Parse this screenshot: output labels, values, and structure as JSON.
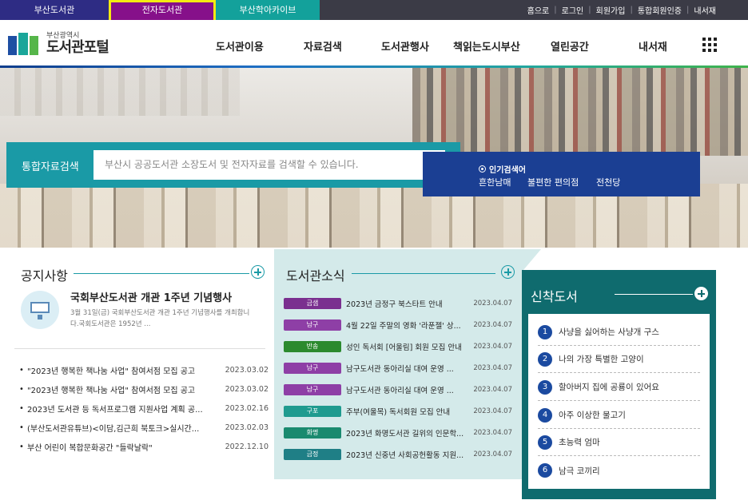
{
  "site_tabs": [
    {
      "label": "부산도서관"
    },
    {
      "label": "전자도서관"
    },
    {
      "label": "부산학아카이브"
    }
  ],
  "util_links": [
    "홈으로",
    "로그인",
    "회원가입",
    "통합회원인증",
    "내서재"
  ],
  "logo": {
    "sub": "부산광역시",
    "main": "도서관포털"
  },
  "gnb": [
    "도서관이용",
    "자료검색",
    "도서관행사",
    "책읽는도시부산",
    "열린공간",
    "내서재"
  ],
  "search": {
    "label": "통합자료검색",
    "placeholder": "부산시 공공도서관 소장도서 및 전자자료를 검색할 수 있습니다."
  },
  "popular": {
    "title": "인기검색어",
    "keywords": [
      "흔한남매",
      "불편한 편의점",
      "전천당"
    ]
  },
  "notice": {
    "title": "공지사항",
    "featured_title": "국회부산도서관 개관 1주년 기념행사",
    "featured_desc": "3월 31일(금) 국회부산도서관 개관 1주년 기념행사를 개최합니다.국회도서관은 1952년 ...",
    "items": [
      {
        "text": "\"2023년 행복한 책나눔 사업\" 참여서점 모집 공고",
        "date": "2023.03.02"
      },
      {
        "text": "\"2023년 행복한 책나눔 사업\" 참여서점 모집 공고",
        "date": "2023.03.02"
      },
      {
        "text": "2023년 도서관 등 독서프로그램 지원사업 계획 공...",
        "date": "2023.02.16"
      },
      {
        "text": "(부산도서관유튜브)<이담,김근희 북토크>실시간...",
        "date": "2023.02.03"
      },
      {
        "text": "부산 어린이 복합문화공간 \"들락날락\"",
        "date": "2022.12.10"
      }
    ]
  },
  "news": {
    "title": "도서관소식",
    "items": [
      {
        "tag": "금샘",
        "color": "#7a2f8f",
        "text": "2023년 금정구 북스타트 안내",
        "date": "2023.04.07"
      },
      {
        "tag": "남구",
        "color": "#8e3fa6",
        "text": "4월 22일 주말의 영화 '라푼젤' 상...",
        "date": "2023.04.07"
      },
      {
        "tag": "반송",
        "color": "#2b8a2e",
        "text": "성인 독서회 [어울림] 회원 모집 안내",
        "date": "2023.04.07"
      },
      {
        "tag": "남구",
        "color": "#8e3fa6",
        "text": "남구도서관 동아리실 대여 운영 ...",
        "date": "2023.04.07"
      },
      {
        "tag": "남구",
        "color": "#8e3fa6",
        "text": "남구도서관 동아리실 대여 운영 ...",
        "date": "2023.04.07"
      },
      {
        "tag": "구포",
        "color": "#1f9b8f",
        "text": "주부(여울목) 독서회원 모집 안내",
        "date": "2023.04.07"
      },
      {
        "tag": "화명",
        "color": "#1a8a6f",
        "text": "2023년 화명도서관 길위의 인문학...",
        "date": "2023.04.07"
      },
      {
        "tag": "금정",
        "color": "#1f7f86",
        "text": "2023년 신중년 사회공헌활동 지원...",
        "date": "2023.04.07"
      }
    ]
  },
  "newbooks": {
    "title": "신착도서",
    "items": [
      {
        "num": "1",
        "text": "사냥을 싫어하는 사냥개 구스"
      },
      {
        "num": "2",
        "text": "나의 가장 특별한 고양이"
      },
      {
        "num": "3",
        "text": "할아버지 집에 공룡이 있어요"
      },
      {
        "num": "4",
        "text": "아주 이상한 물고기"
      },
      {
        "num": "5",
        "text": "초능력 엄마"
      },
      {
        "num": "6",
        "text": "남극 코끼리"
      }
    ]
  }
}
